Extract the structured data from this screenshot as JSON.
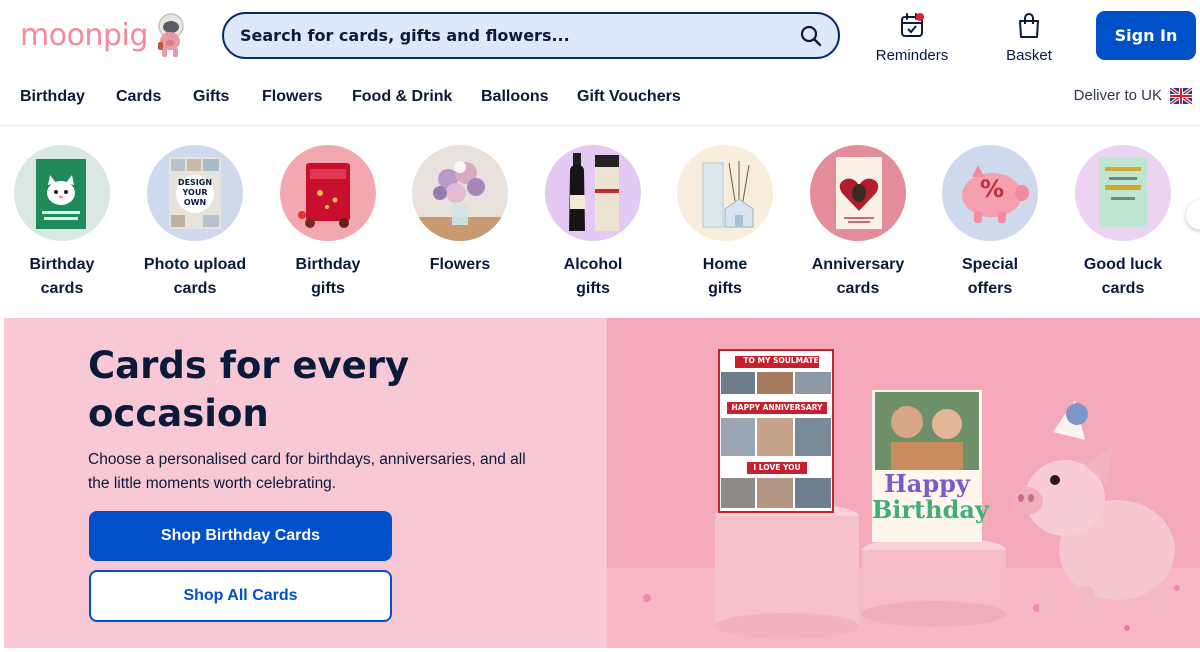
{
  "header": {
    "logo_text": "moonpig",
    "search_placeholder": "Search for cards, gifts and flowers...",
    "reminders_label": "Reminders",
    "basket_label": "Basket",
    "signin_label": "Sign In"
  },
  "nav": {
    "items": [
      "Birthday",
      "Cards",
      "Gifts",
      "Flowers",
      "Food & Drink",
      "Balloons",
      "Gift Vouchers"
    ],
    "deliver_label": "Deliver to UK"
  },
  "categories": [
    {
      "line1": "Birthday",
      "line2": "cards",
      "bg": "#d9e8e3"
    },
    {
      "line1": "Photo upload",
      "line2": "cards",
      "bg": "#cfd9ee"
    },
    {
      "line1": "Birthday",
      "line2": "gifts",
      "bg": "#f3a7b1"
    },
    {
      "line1": "Flowers",
      "line2": "",
      "bg": "#e9e2dc"
    },
    {
      "line1": "Alcohol",
      "line2": "gifts",
      "bg": "#e3c9f3"
    },
    {
      "line1": "Home",
      "line2": "gifts",
      "bg": "#f8eedb"
    },
    {
      "line1": "Anniversary",
      "line2": "cards",
      "bg": "#e38c9a"
    },
    {
      "line1": "Special",
      "line2": "offers",
      "bg": "#cfd9ee"
    },
    {
      "line1": "Good luck",
      "line2": "cards",
      "bg": "#ecd3f3"
    }
  ],
  "category_art": {
    "photo_upload_text": [
      "DESIGN",
      "YOUR",
      "OWN"
    ],
    "special_offer_symbol": "%"
  },
  "hero": {
    "title": "Cards for every occasion",
    "description": "Choose a personalised card for birthdays, anniversaries, and all the little moments worth celebrating.",
    "primary_button": "Shop Birthday Cards",
    "secondary_button": "Shop All Cards",
    "card1_lines": [
      "TO MY SOULMATE",
      "HAPPY ANNIVERSARY",
      "I LOVE YOU"
    ],
    "card2_lines": [
      "Happy",
      "Birthday"
    ]
  },
  "colors": {
    "brand_blue": "#0050c9",
    "navy": "#0a1a3a",
    "logo_pink": "#f58a9b",
    "hero_left_bg": "#f8c9d5",
    "hero_right_bg": "#f4a9b8"
  }
}
